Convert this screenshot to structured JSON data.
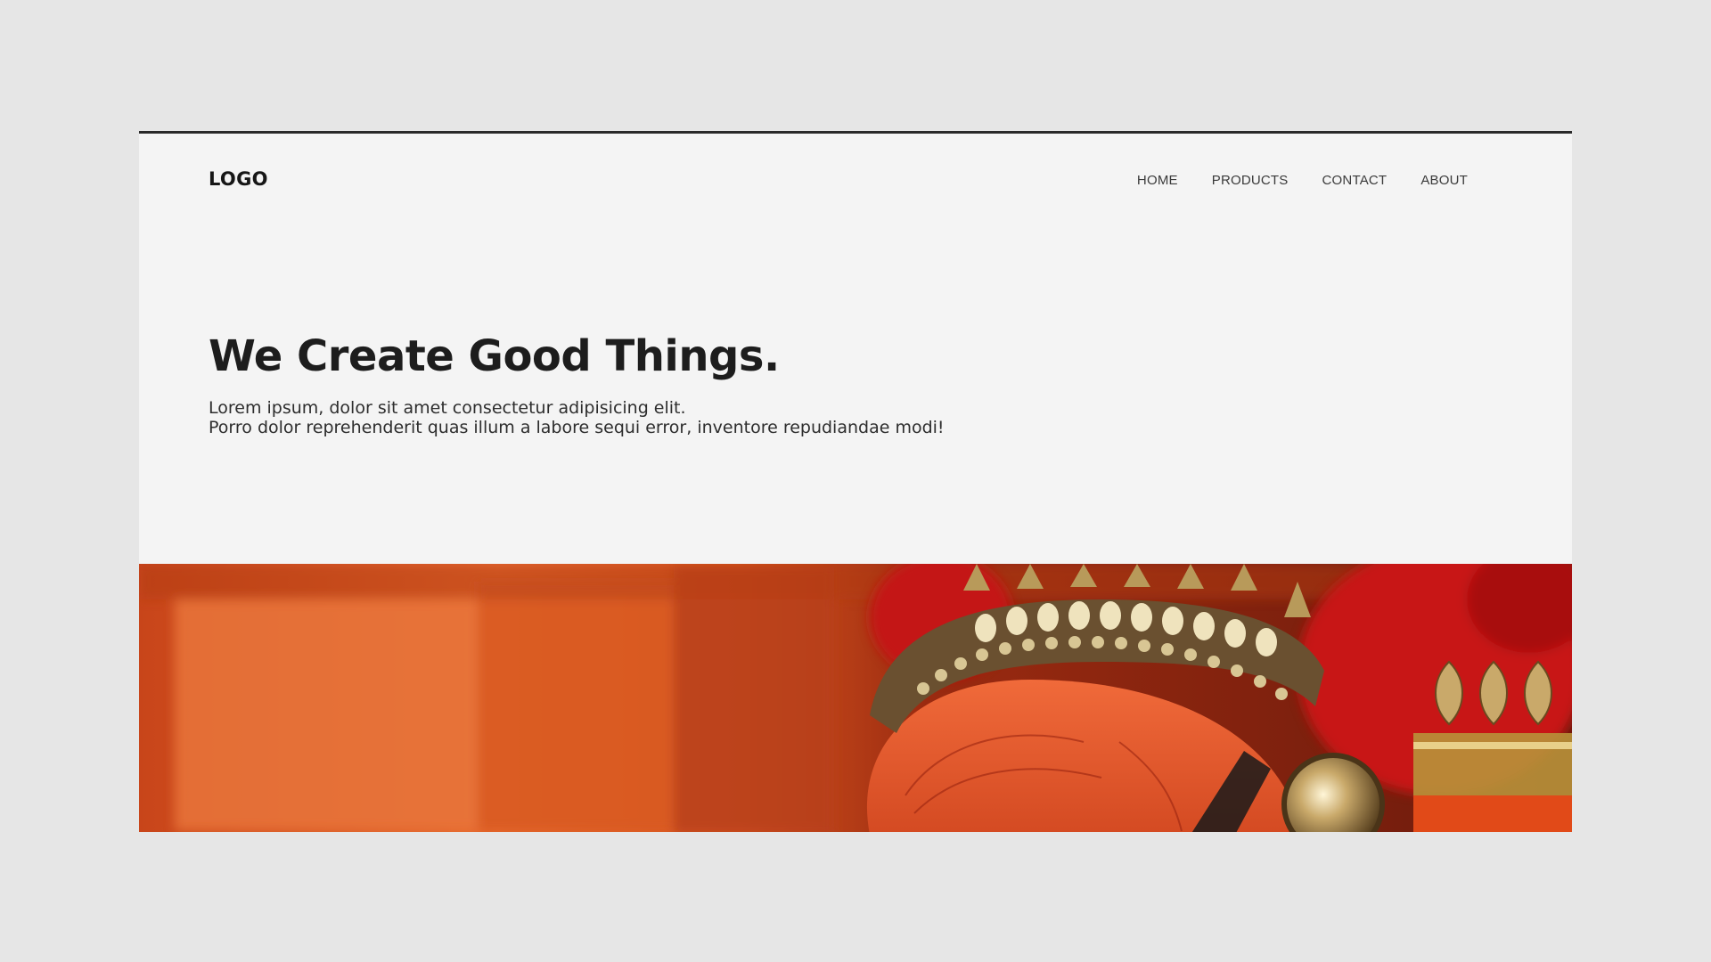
{
  "header": {
    "logo": "LOGO",
    "nav": [
      {
        "label": "HOME"
      },
      {
        "label": "PRODUCTS"
      },
      {
        "label": "CONTACT"
      },
      {
        "label": "ABOUT"
      }
    ]
  },
  "hero": {
    "title": "We Create Good Things.",
    "text_line1": "Lorem ipsum, dolor sit amet consectetur adipisicing elit.",
    "text_line2": "Porro dolor reprehenderit quas illum a labore sequi error, inventore repudiandae modi!"
  },
  "colors": {
    "page_bg": "#e6e6e6",
    "panel_bg": "#f4f4f4",
    "top_border": "#2a2a2a",
    "image_primary": "#e0592a",
    "image_gold": "#c9b07a"
  }
}
